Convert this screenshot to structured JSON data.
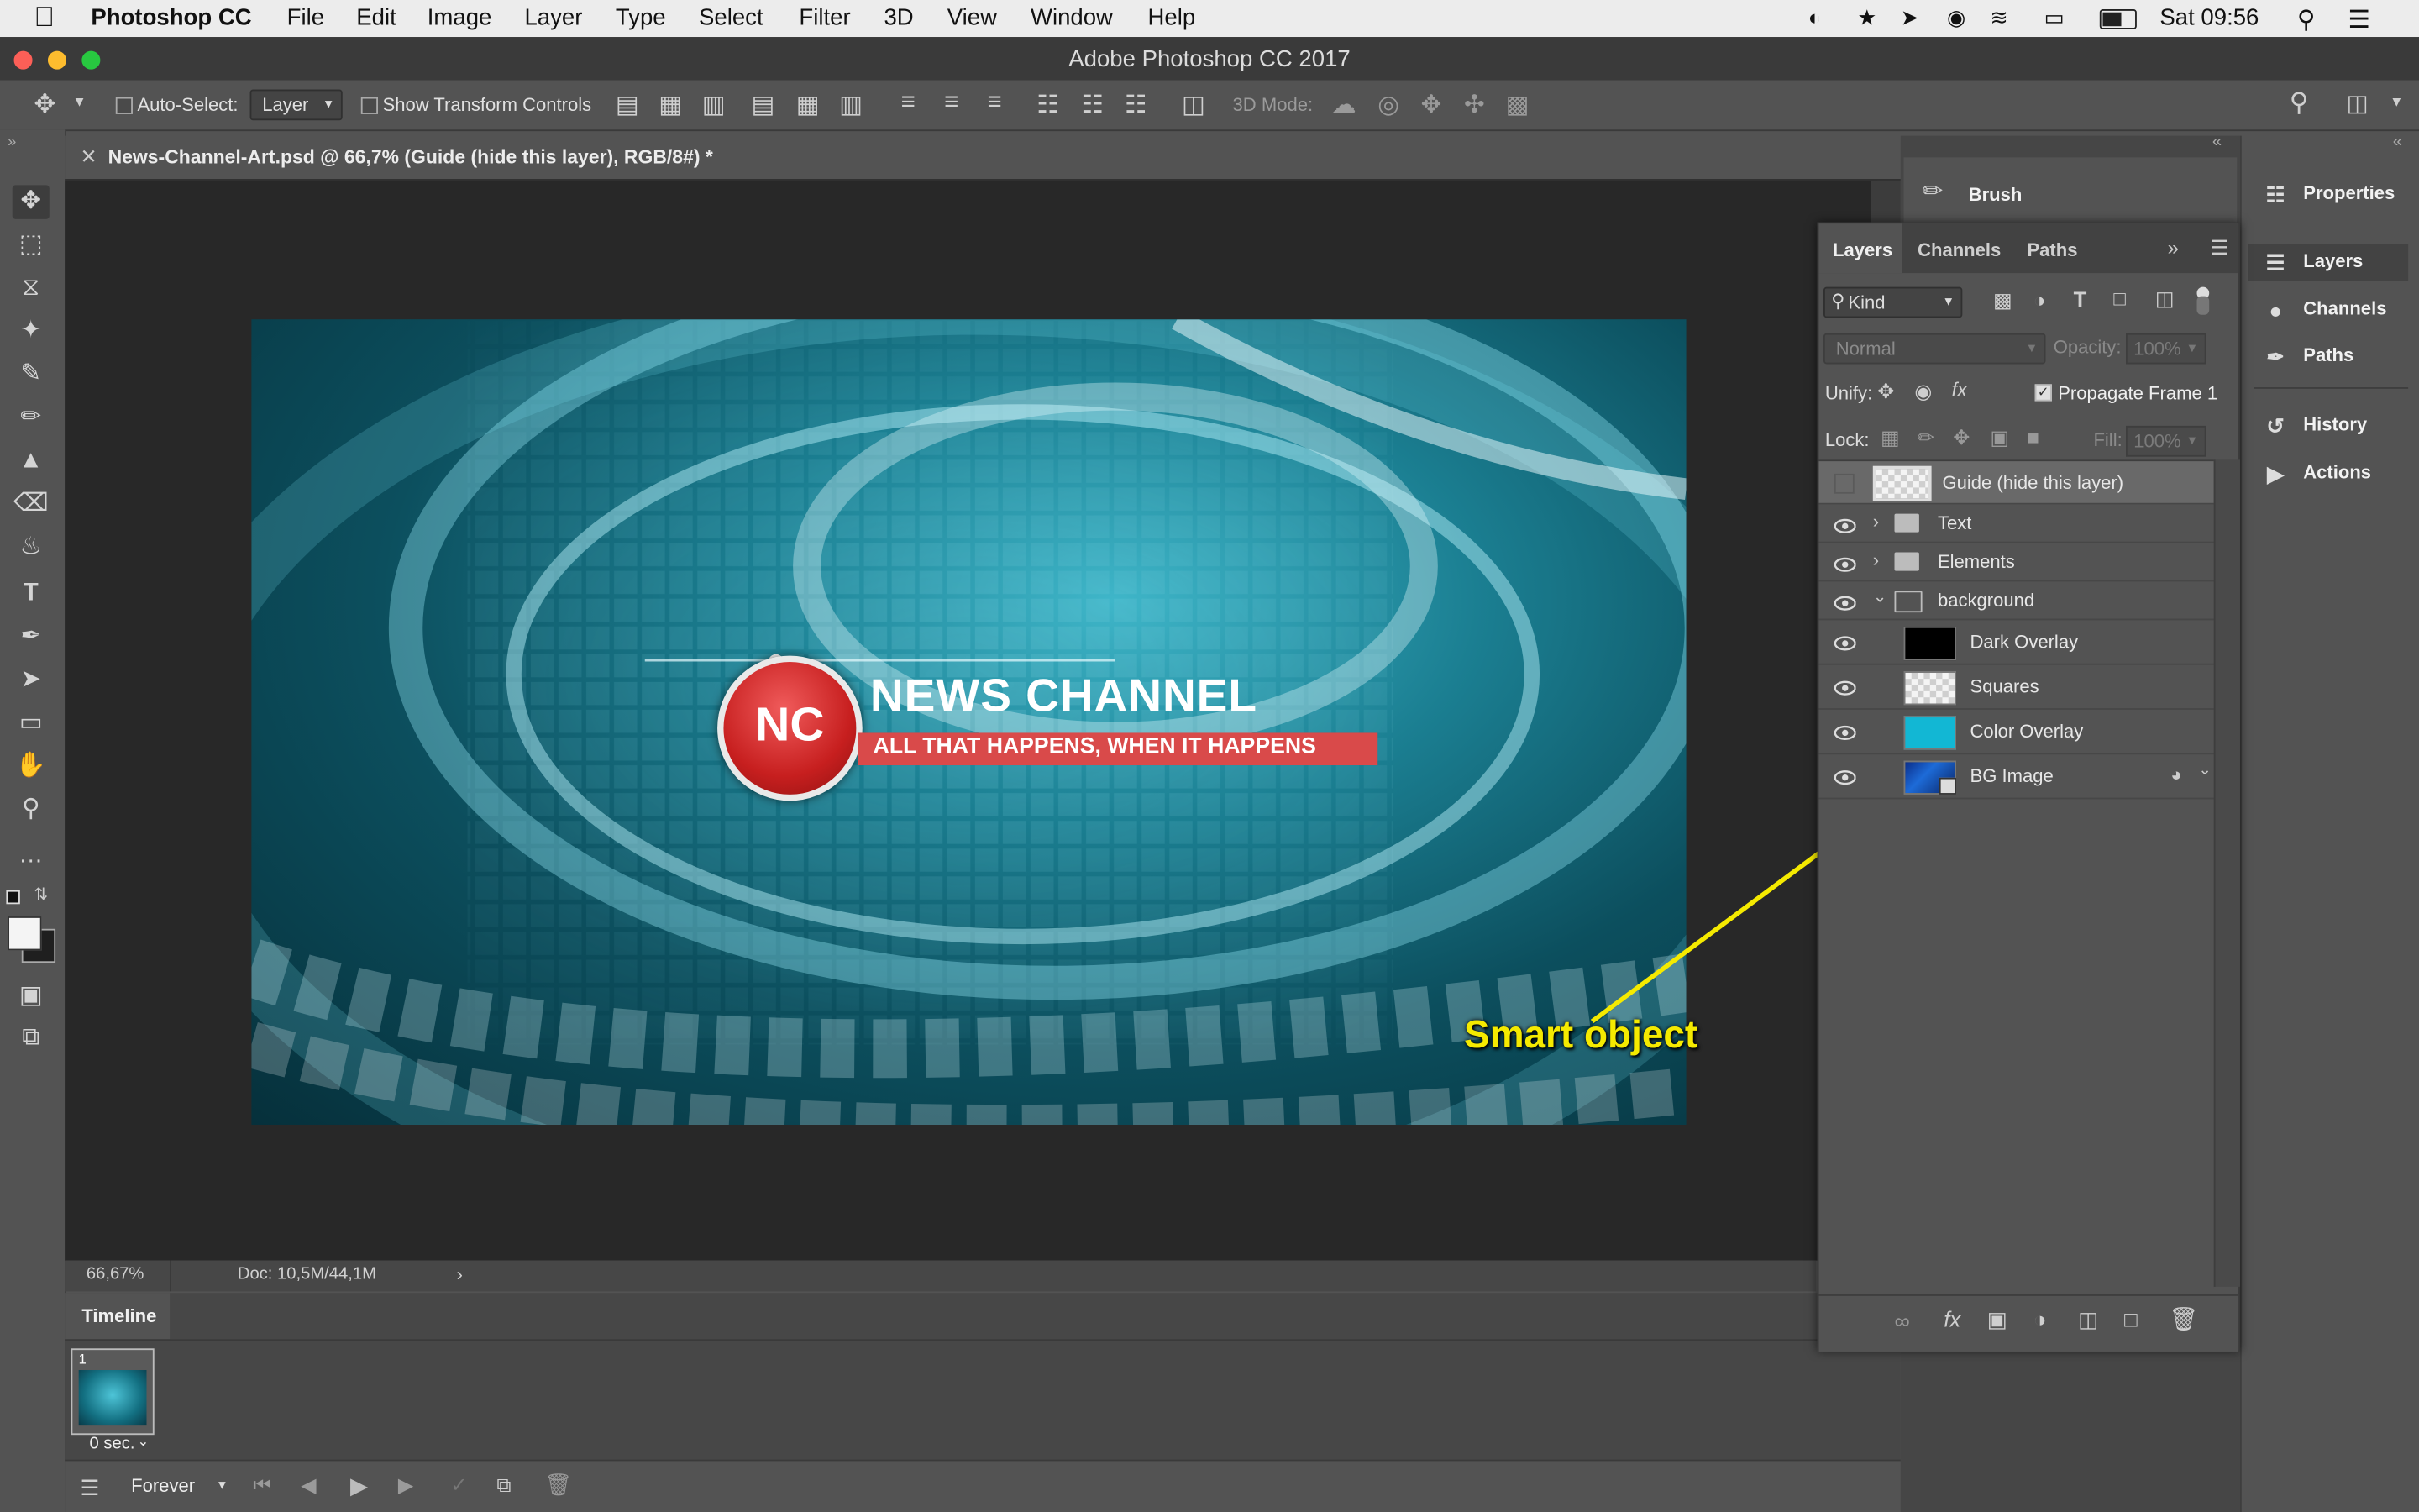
{
  "menubar": {
    "apple": "",
    "app": "Photoshop CC",
    "items": [
      "File",
      "Edit",
      "Image",
      "Layer",
      "Type",
      "Select",
      "Filter",
      "3D",
      "View",
      "Window",
      "Help"
    ],
    "clock": "Sat 09:56"
  },
  "window": {
    "title": "Adobe Photoshop CC 2017"
  },
  "options": {
    "auto_select": "Auto-Select:",
    "layer_select": "Layer",
    "show_transform": "Show Transform Controls",
    "mode_3d": "3D Mode:"
  },
  "document": {
    "tab": "News-Channel-Art.psd @ 66,7% (Guide (hide this layer), RGB/8#) *",
    "zoom": "66,67%",
    "doc_size": "Doc: 10,5M/44,1M"
  },
  "artwork": {
    "logo": "NC",
    "headline": "NEWS CHANNEL",
    "tagline": "ALL THAT HAPPENS, WHEN IT HAPPENS"
  },
  "annotation": {
    "text": "Smart object",
    "color": "#f5ea00"
  },
  "timeline": {
    "title": "Timeline",
    "frame_number": "1",
    "frame_delay": "0 sec.",
    "loop": "Forever"
  },
  "brush_panel": {
    "label": "Brush"
  },
  "layers_panel": {
    "tabs": [
      "Layers",
      "Channels",
      "Paths"
    ],
    "kind": "Kind",
    "blend": "Normal",
    "opacity_label": "Opacity:",
    "opacity_value": "100%",
    "unify": "Unify:",
    "propagate": "Propagate Frame 1",
    "lock": "Lock:",
    "fill_label": "Fill:",
    "fill_value": "100%",
    "layers": [
      {
        "name": "Guide (hide this layer)"
      },
      {
        "name": "Text"
      },
      {
        "name": "Elements"
      },
      {
        "name": "background"
      },
      {
        "name": "Dark Overlay"
      },
      {
        "name": "Squares"
      },
      {
        "name": "Color Overlay"
      },
      {
        "name": "BG Image"
      }
    ]
  },
  "side_panels": [
    "Properties",
    "Layers",
    "Channels",
    "Paths",
    "History",
    "Actions"
  ],
  "colors": {
    "accent_cyan": "#12b7d4",
    "logo_red": "#d42a2a",
    "panel_bg": "#535353"
  }
}
